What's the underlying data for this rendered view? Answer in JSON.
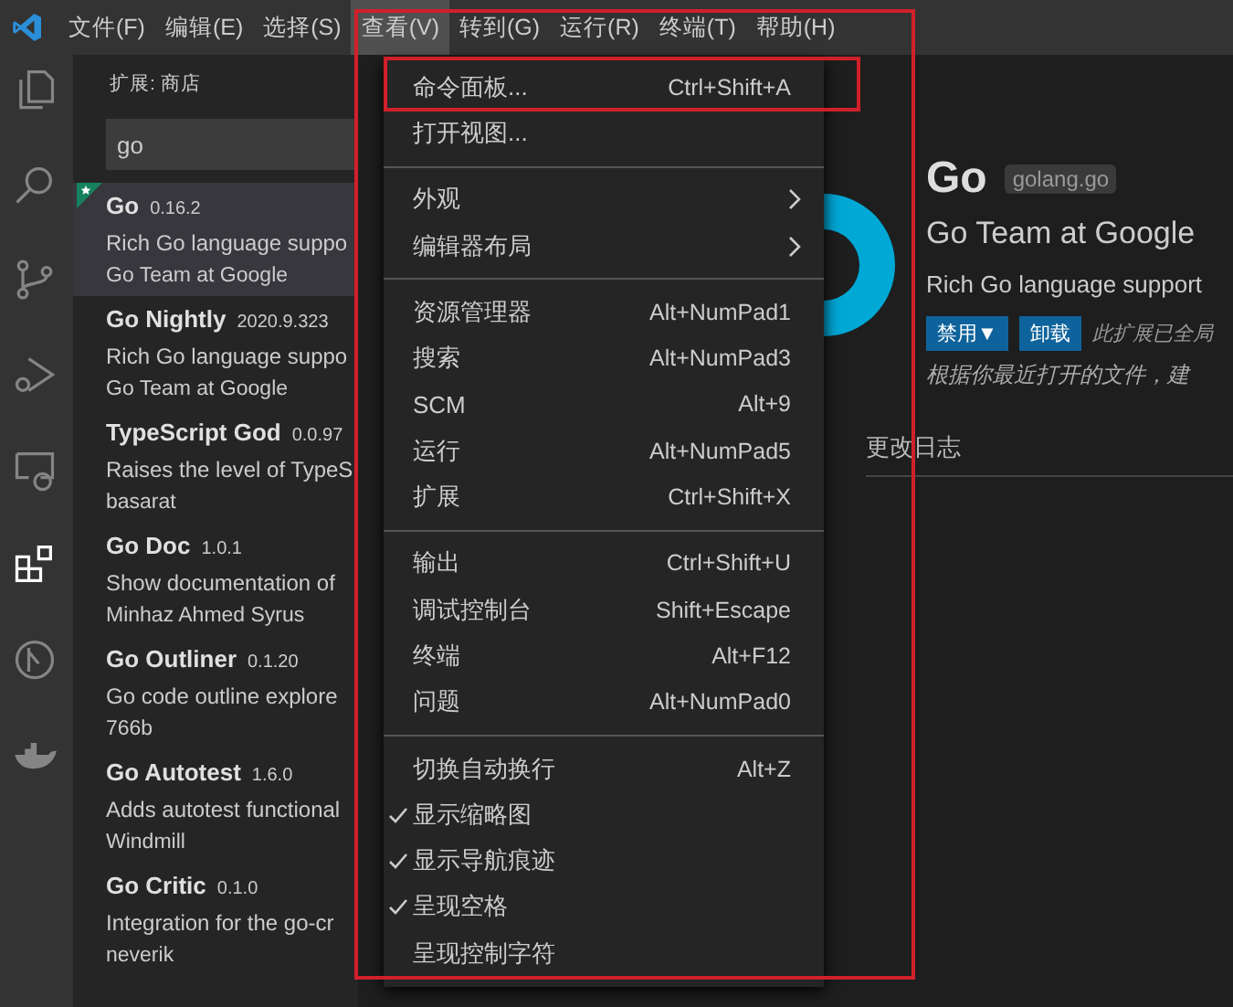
{
  "menubar": [
    {
      "label": "文件(F)",
      "selected": false
    },
    {
      "label": "编辑(E)",
      "selected": false
    },
    {
      "label": "选择(S)",
      "selected": false
    },
    {
      "label": "查看(V)",
      "selected": true
    },
    {
      "label": "转到(G)",
      "selected": false
    },
    {
      "label": "运行(R)",
      "selected": false
    },
    {
      "label": "终端(T)",
      "selected": false
    },
    {
      "label": "帮助(H)",
      "selected": false
    }
  ],
  "activity_bar": [
    {
      "kind": "files",
      "selected": false
    },
    {
      "kind": "search",
      "selected": false
    },
    {
      "kind": "scm",
      "selected": false
    },
    {
      "kind": "debug",
      "selected": false
    },
    {
      "kind": "remote",
      "selected": false
    },
    {
      "kind": "extensions",
      "selected": true
    },
    {
      "kind": "git",
      "selected": false
    },
    {
      "kind": "docker",
      "selected": false
    }
  ],
  "sidebar": {
    "title": "扩展: 商店",
    "search": {
      "value": "go"
    },
    "items": [
      {
        "name": "Go",
        "version": "0.16.2",
        "description": "Rich Go language suppo",
        "publisher": "Go Team at Google",
        "selected": true,
        "starred": true
      },
      {
        "name": "Go Nightly",
        "version": "2020.9.323",
        "description": "Rich Go language suppo",
        "publisher": "Go Team at Google",
        "selected": false,
        "starred": false
      },
      {
        "name": "TypeScript God",
        "version": "0.0.97",
        "description": "Raises the level of TypeS",
        "publisher": "basarat",
        "selected": false,
        "starred": false
      },
      {
        "name": "Go Doc",
        "version": "1.0.1",
        "description": "Show documentation of",
        "publisher": "Minhaz Ahmed Syrus",
        "selected": false,
        "starred": false
      },
      {
        "name": "Go Outliner",
        "version": "0.1.20",
        "description": "Go code outline explore",
        "publisher": "766b",
        "selected": false,
        "starred": false
      },
      {
        "name": "Go Autotest",
        "version": "1.6.0",
        "description": "Adds autotest functional",
        "publisher": "Windmill",
        "selected": false,
        "starred": false
      },
      {
        "name": "Go Critic",
        "version": "0.1.0",
        "description": "Integration for the go-cr",
        "publisher": "neverik",
        "selected": false,
        "starred": false
      }
    ]
  },
  "menu": {
    "groups": [
      [
        {
          "label": "命令面板...",
          "shortcut": "Ctrl+Shift+A",
          "kind": "command",
          "checked": false
        },
        {
          "label": "打开视图...",
          "kind": "command",
          "checked": false
        }
      ],
      [
        {
          "label": "外观",
          "kind": "submenu",
          "checked": false
        },
        {
          "label": "编辑器布局",
          "kind": "submenu",
          "checked": false
        }
      ],
      [
        {
          "label": "资源管理器",
          "shortcut": "Alt+NumPad1",
          "kind": "command",
          "checked": false
        },
        {
          "label": "搜索",
          "shortcut": "Alt+NumPad3",
          "kind": "command",
          "checked": false
        },
        {
          "label": "SCM",
          "shortcut": "Alt+9",
          "kind": "command",
          "checked": false
        },
        {
          "label": "运行",
          "shortcut": "Alt+NumPad5",
          "kind": "command",
          "checked": false
        },
        {
          "label": "扩展",
          "shortcut": "Ctrl+Shift+X",
          "kind": "command",
          "checked": false
        }
      ],
      [
        {
          "label": "输出",
          "shortcut": "Ctrl+Shift+U",
          "kind": "command",
          "checked": false
        },
        {
          "label": "调试控制台",
          "shortcut": "Shift+Escape",
          "kind": "command",
          "checked": false
        },
        {
          "label": "终端",
          "shortcut": "Alt+F12",
          "kind": "command",
          "checked": false
        },
        {
          "label": "问题",
          "shortcut": "Alt+NumPad0",
          "kind": "command",
          "checked": false
        }
      ],
      [
        {
          "label": "切换自动换行",
          "shortcut": "Alt+Z",
          "kind": "command",
          "checked": false
        },
        {
          "label": "显示缩略图",
          "kind": "command",
          "checked": true
        },
        {
          "label": "显示导航痕迹",
          "kind": "command",
          "checked": true
        },
        {
          "label": "呈现空格",
          "kind": "command",
          "checked": true
        },
        {
          "label": "呈现控制字符",
          "kind": "command",
          "checked": false
        }
      ]
    ]
  },
  "detail": {
    "name": "Go",
    "id": "golang.go",
    "publisher": "Go Team at Google",
    "description": "Rich Go language support",
    "buttons": [
      "禁用▼",
      "卸载"
    ],
    "status": "此扩展已全局",
    "recommendation": "根据你最近打开的文件，建",
    "tabs": [
      "更改日志"
    ]
  }
}
